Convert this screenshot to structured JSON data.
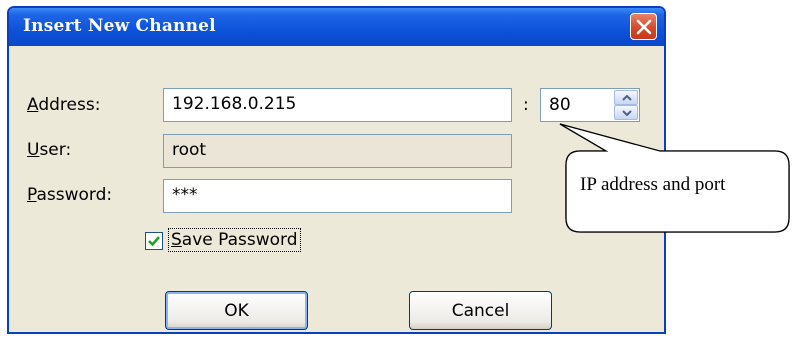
{
  "dialog": {
    "title": "Insert New Channel",
    "close_label": "✕"
  },
  "form": {
    "address_label_first": "A",
    "address_label_rest": "ddress:",
    "address_value": "192.168.0.215",
    "colon": ":",
    "port_value": "80",
    "user_label_first": "U",
    "user_label_rest": "ser:",
    "user_value": "root",
    "password_label_first": "P",
    "password_label_rest": "assword:",
    "password_value": "***",
    "save_password_first": "S",
    "save_password_rest": "ave Password",
    "save_password_checked": true
  },
  "buttons": {
    "ok": "OK",
    "cancel": "Cancel"
  },
  "callout": {
    "text": "IP address and port"
  }
}
